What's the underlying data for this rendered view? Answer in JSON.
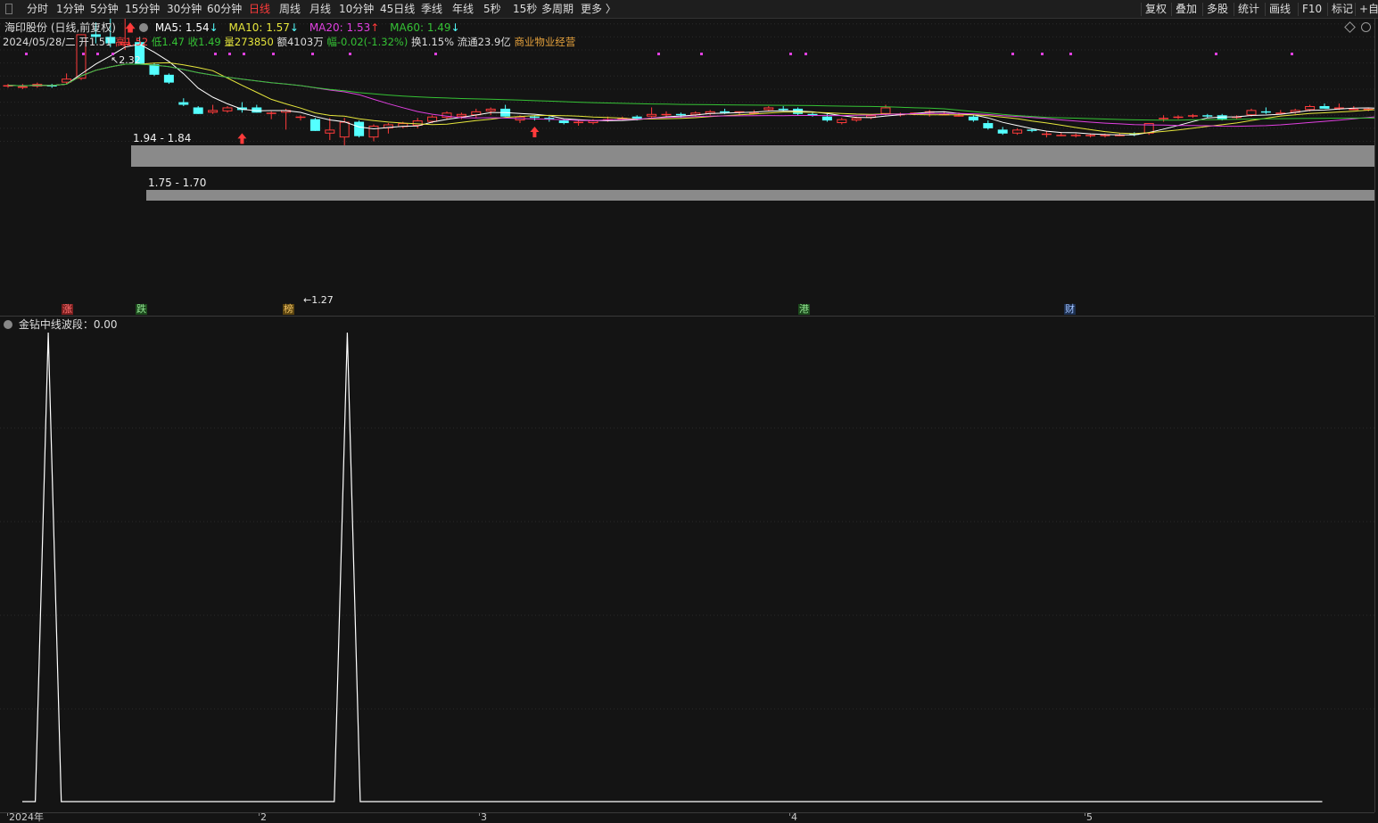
{
  "toolbar": {
    "periods": [
      "分时",
      "1分钟",
      "5分钟",
      "15分钟",
      "30分钟",
      "60分钟",
      "日线",
      "周线",
      "月线",
      "10分钟",
      "45日线",
      "季线",
      "年线",
      "5秒",
      "15秒",
      "多周期",
      "更多 〉"
    ],
    "active_period": "日线",
    "right_tools": [
      "复权",
      "叠加",
      "多股",
      "统计",
      "画线",
      "F10",
      "标记",
      "+自"
    ]
  },
  "quote": {
    "title": "海印股份 (日线,前复权)",
    "ma5": "MA5: 1.54",
    "ma10": "MA10: 1.57",
    "ma20": "MA20: 1.53",
    "ma60": "MA60: 1.49",
    "date": "2024/05/28/二",
    "open": "开1.51",
    "high": "高1.52",
    "low": "低1.47",
    "close": "收1.49",
    "volume": "量273850",
    "amount": "额4103万",
    "change": "幅-0.02(-1.32%)",
    "turnover": "换1.15%",
    "float_cap": "流通23.9亿",
    "industry": "商业物业经营"
  },
  "colors": {
    "up": "#ff3b3b",
    "down": "#54ffff",
    "ma5": "#ffffff",
    "ma10": "#e6e63c",
    "ma20": "#e040e0",
    "ma60": "#35c235",
    "accent": "#e6a23c"
  },
  "icons": [
    "arrow-up-icon",
    "settings-icon",
    "expand-icon",
    "window-icon"
  ],
  "annotations": {
    "high": "2.32",
    "low": "1.27",
    "zone1": "1.94 - 1.84",
    "zone2": "1.75 - 1.70"
  },
  "events": [
    "涨",
    "跌",
    "榜",
    "港",
    "财"
  ],
  "indicator": {
    "title": "金钻中线波段：0.00"
  },
  "xaxis": [
    "2024年",
    "2",
    "3",
    "4",
    "5"
  ],
  "chart_data": [
    {
      "type": "candlestick",
      "price_range": [
        1.22,
        2.42
      ],
      "ohlc": [
        [
          1.73,
          1.74,
          1.71,
          1.73
        ],
        [
          1.71,
          1.74,
          1.7,
          1.72
        ],
        [
          1.72,
          1.75,
          1.71,
          1.74
        ],
        [
          1.73,
          1.74,
          1.71,
          1.72
        ],
        [
          1.75,
          1.82,
          1.74,
          1.78
        ],
        [
          1.78,
          2.12,
          1.77,
          2.12
        ],
        [
          2.12,
          2.21,
          2.05,
          2.1
        ],
        [
          2.1,
          2.28,
          2.02,
          2.05
        ],
        [
          2.04,
          2.32,
          2.0,
          2.06
        ],
        [
          2.06,
          2.1,
          1.9,
          1.89
        ],
        [
          1.89,
          1.9,
          1.8,
          1.81
        ],
        [
          1.81,
          1.82,
          1.74,
          1.75
        ],
        [
          1.6,
          1.63,
          1.57,
          1.58
        ],
        [
          1.56,
          1.57,
          1.51,
          1.51
        ],
        [
          1.52,
          1.58,
          1.51,
          1.54
        ],
        [
          1.53,
          1.57,
          1.52,
          1.56
        ],
        [
          1.56,
          1.6,
          1.52,
          1.54
        ],
        [
          1.56,
          1.58,
          1.52,
          1.52
        ],
        [
          1.51,
          1.53,
          1.47,
          1.52
        ],
        [
          1.52,
          1.55,
          1.39,
          1.54
        ],
        [
          1.49,
          1.5,
          1.46,
          1.49
        ],
        [
          1.47,
          1.48,
          1.38,
          1.38
        ],
        [
          1.36,
          1.48,
          1.31,
          1.39
        ],
        [
          1.33,
          1.48,
          1.27,
          1.45
        ],
        [
          1.45,
          1.46,
          1.33,
          1.34
        ],
        [
          1.33,
          1.43,
          1.3,
          1.42
        ],
        [
          1.4,
          1.44,
          1.36,
          1.43
        ],
        [
          1.41,
          1.45,
          1.4,
          1.44
        ],
        [
          1.42,
          1.48,
          1.4,
          1.46
        ],
        [
          1.45,
          1.5,
          1.44,
          1.49
        ],
        [
          1.48,
          1.53,
          1.47,
          1.52
        ],
        [
          1.49,
          1.52,
          1.47,
          1.51
        ],
        [
          1.5,
          1.55,
          1.48,
          1.53
        ],
        [
          1.53,
          1.56,
          1.5,
          1.55
        ],
        [
          1.55,
          1.58,
          1.49,
          1.49
        ],
        [
          1.46,
          1.5,
          1.44,
          1.49
        ],
        [
          1.49,
          1.5,
          1.46,
          1.48
        ],
        [
          1.48,
          1.49,
          1.45,
          1.47
        ],
        [
          1.46,
          1.47,
          1.43,
          1.44
        ],
        [
          1.44,
          1.46,
          1.42,
          1.45
        ],
        [
          1.44,
          1.47,
          1.43,
          1.46
        ],
        [
          1.47,
          1.49,
          1.45,
          1.47
        ],
        [
          1.47,
          1.49,
          1.46,
          1.48
        ],
        [
          1.49,
          1.5,
          1.46,
          1.47
        ],
        [
          1.49,
          1.56,
          1.48,
          1.51
        ],
        [
          1.51,
          1.53,
          1.49,
          1.51
        ],
        [
          1.51,
          1.52,
          1.48,
          1.5
        ],
        [
          1.5,
          1.53,
          1.49,
          1.52
        ],
        [
          1.51,
          1.54,
          1.5,
          1.53
        ],
        [
          1.53,
          1.55,
          1.51,
          1.52
        ],
        [
          1.52,
          1.53,
          1.5,
          1.53
        ],
        [
          1.52,
          1.54,
          1.51,
          1.52
        ],
        [
          1.54,
          1.57,
          1.53,
          1.56
        ],
        [
          1.55,
          1.57,
          1.53,
          1.54
        ],
        [
          1.55,
          1.56,
          1.5,
          1.51
        ],
        [
          1.51,
          1.52,
          1.49,
          1.5
        ],
        [
          1.49,
          1.51,
          1.45,
          1.46
        ],
        [
          1.44,
          1.48,
          1.43,
          1.47
        ],
        [
          1.46,
          1.49,
          1.45,
          1.48
        ],
        [
          1.48,
          1.51,
          1.47,
          1.5
        ],
        [
          1.51,
          1.58,
          1.5,
          1.56
        ],
        [
          1.51,
          1.52,
          1.49,
          1.51
        ],
        [
          1.51,
          1.52,
          1.5,
          1.52
        ],
        [
          1.52,
          1.54,
          1.49,
          1.53
        ],
        [
          1.51,
          1.53,
          1.5,
          1.51
        ],
        [
          1.5,
          1.52,
          1.49,
          1.5
        ],
        [
          1.49,
          1.5,
          1.45,
          1.46
        ],
        [
          1.44,
          1.46,
          1.39,
          1.4
        ],
        [
          1.39,
          1.41,
          1.35,
          1.36
        ],
        [
          1.36,
          1.4,
          1.35,
          1.39
        ],
        [
          1.39,
          1.4,
          1.37,
          1.38
        ],
        [
          1.36,
          1.38,
          1.33,
          1.36
        ],
        [
          1.35,
          1.37,
          1.34,
          1.35
        ],
        [
          1.35,
          1.36,
          1.33,
          1.35
        ],
        [
          1.34,
          1.36,
          1.33,
          1.35
        ],
        [
          1.34,
          1.36,
          1.33,
          1.35
        ],
        [
          1.35,
          1.36,
          1.34,
          1.35
        ],
        [
          1.36,
          1.37,
          1.34,
          1.35
        ],
        [
          1.36,
          1.44,
          1.35,
          1.44
        ],
        [
          1.47,
          1.5,
          1.45,
          1.48
        ],
        [
          1.48,
          1.5,
          1.47,
          1.49
        ],
        [
          1.49,
          1.51,
          1.48,
          1.5
        ],
        [
          1.5,
          1.51,
          1.48,
          1.49
        ],
        [
          1.5,
          1.51,
          1.46,
          1.47
        ],
        [
          1.48,
          1.5,
          1.47,
          1.49
        ],
        [
          1.5,
          1.55,
          1.49,
          1.54
        ],
        [
          1.53,
          1.56,
          1.51,
          1.52
        ],
        [
          1.52,
          1.54,
          1.51,
          1.52
        ],
        [
          1.52,
          1.55,
          1.51,
          1.54
        ],
        [
          1.54,
          1.58,
          1.53,
          1.57
        ],
        [
          1.57,
          1.59,
          1.55,
          1.55
        ],
        [
          1.56,
          1.59,
          1.54,
          1.56
        ],
        [
          1.55,
          1.57,
          1.54,
          1.55
        ],
        [
          1.55,
          1.56,
          1.53,
          1.55
        ],
        [
          1.54,
          1.56,
          1.52,
          1.55
        ],
        [
          1.55,
          1.56,
          1.51,
          1.52
        ],
        [
          1.52,
          1.53,
          1.5,
          1.5
        ],
        [
          1.51,
          1.53,
          1.5,
          1.52
        ],
        [
          1.51,
          1.52,
          1.47,
          1.49
        ]
      ],
      "zones": [
        [
          1.94,
          1.84
        ],
        [
          1.75,
          1.7
        ]
      ]
    },
    {
      "type": "line",
      "ylim": [
        0,
        1
      ],
      "values": [
        0,
        0,
        1,
        0,
        0,
        0,
        0,
        0,
        0,
        0,
        0,
        0,
        0,
        0,
        0,
        0,
        0,
        0,
        0,
        0,
        0,
        0,
        0,
        0,
        0,
        1,
        0,
        0,
        0,
        0,
        0,
        0,
        0,
        0,
        0,
        0,
        0,
        0,
        0,
        0,
        0,
        0,
        0,
        0,
        0,
        0,
        0,
        0,
        0,
        0,
        0,
        0,
        0,
        0,
        0,
        0,
        0,
        0,
        0,
        0,
        0,
        0,
        0,
        0,
        0,
        0,
        0,
        0,
        0,
        0,
        0,
        0,
        0,
        0,
        0,
        0,
        0,
        0,
        0,
        0,
        0,
        0,
        0,
        0,
        0,
        0,
        0,
        0,
        0,
        0,
        0,
        0,
        0,
        0,
        0,
        0,
        0,
        0,
        0,
        0,
        0
      ]
    }
  ]
}
